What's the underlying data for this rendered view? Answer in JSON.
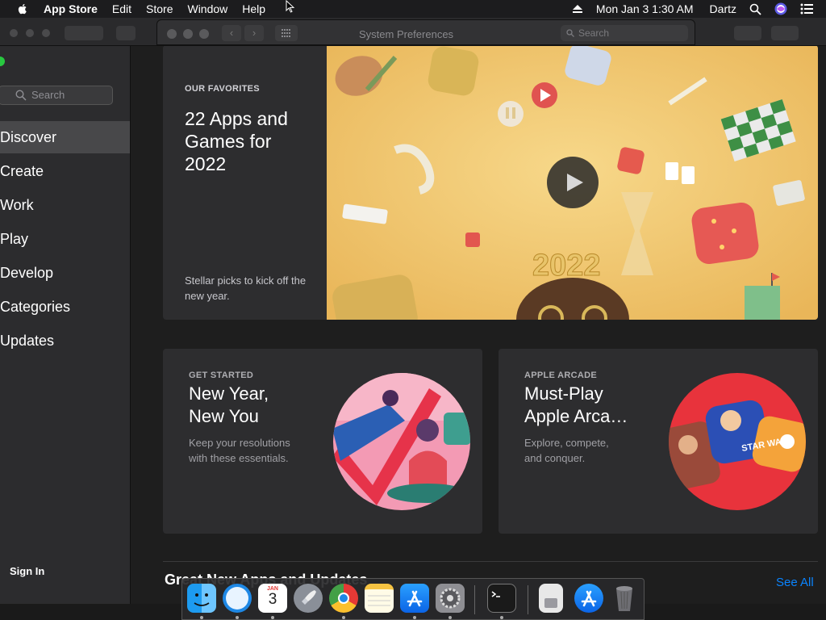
{
  "menubar": {
    "app_name": "App Store",
    "menus": [
      "Edit",
      "Store",
      "Window",
      "Help"
    ],
    "datetime": "Mon Jan 3  1:30 AM",
    "user": "Dartz"
  },
  "sysprefs": {
    "title": "System Preferences",
    "search_placeholder": "Search"
  },
  "sidebar": {
    "search_placeholder": "Search",
    "items": [
      {
        "label": "Discover",
        "active": true
      },
      {
        "label": "Create"
      },
      {
        "label": "Work"
      },
      {
        "label": "Play"
      },
      {
        "label": "Develop"
      },
      {
        "label": "Categories"
      },
      {
        "label": "Updates"
      }
    ],
    "sign_in": "Sign In"
  },
  "hero": {
    "eyebrow": "OUR FAVORITES",
    "title": "22 Apps and Games for 2022",
    "subtitle": "Stellar picks to kick off the new year.",
    "year_art": "2022"
  },
  "cards": [
    {
      "eyebrow": "GET STARTED",
      "title_line1": "New Year,",
      "title_line2": "New You",
      "desc_line1": "Keep your resolutions",
      "desc_line2": "with these essentials."
    },
    {
      "eyebrow": "APPLE ARCADE",
      "title_line1": "Must-Play",
      "title_line2": "Apple Arca…",
      "desc_line1": "Explore, compete,",
      "desc_line2": "and conquer.",
      "art_text": "STAR WARS"
    }
  ],
  "section": {
    "title": "Great New Apps and Updates",
    "see_all": "See All"
  },
  "dock": {
    "calendar_month": "JAN",
    "calendar_day": "3"
  },
  "colors": {
    "accent": "#0a84ff",
    "hero_bg": "#f2c56b"
  }
}
